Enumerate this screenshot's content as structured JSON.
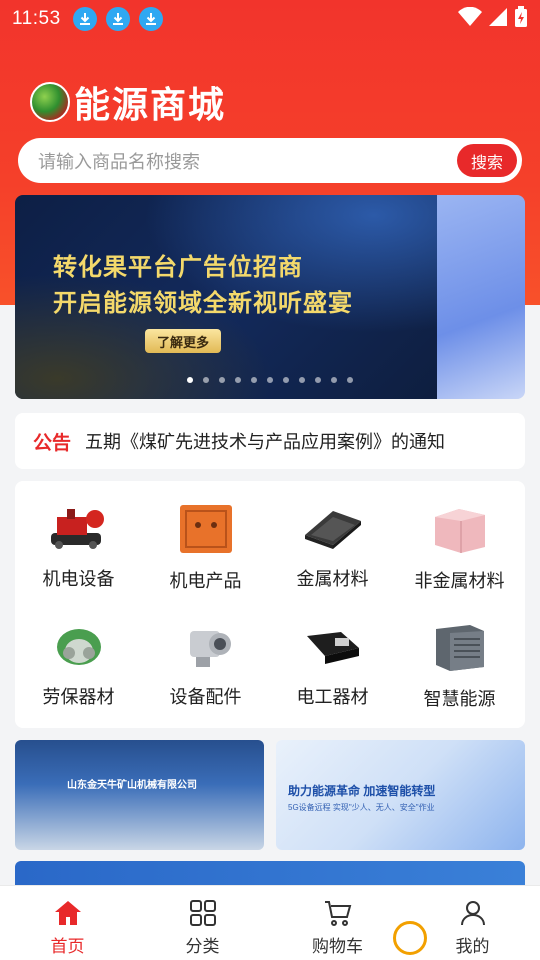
{
  "status_bar": {
    "time": "11:53"
  },
  "header": {
    "logo_text": "能源商城"
  },
  "search": {
    "placeholder": "请输入商品名称搜索",
    "button_label": "搜索"
  },
  "banner": {
    "line1": "转化果平台广告位招商",
    "line2": "开启能源领域全新视听盛宴",
    "button_label": "了解更多",
    "dot_count": 11,
    "active_dot": 0
  },
  "notice": {
    "label": "公告",
    "text": "五期《煤矿先进技术与产品应用案例》的通知"
  },
  "categories": [
    {
      "label": "机电设备",
      "icon": "mining-machine-icon"
    },
    {
      "label": "机电产品",
      "icon": "electrical-box-icon"
    },
    {
      "label": "金属材料",
      "icon": "metal-frame-icon"
    },
    {
      "label": "非金属材料",
      "icon": "pink-blocks-icon"
    },
    {
      "label": "劳保器材",
      "icon": "respirator-mask-icon"
    },
    {
      "label": "设备配件",
      "icon": "camera-part-icon"
    },
    {
      "label": "电工器材",
      "icon": "connector-icon"
    },
    {
      "label": "智慧能源",
      "icon": "cabinet-icon"
    }
  ],
  "ads": [
    {
      "title": "山东金天牛矿山机械有限公司"
    },
    {
      "title": "助力能源革命 加速智能转型",
      "sub": "5G设备远程 实现\"少人、无人、安全\"作业"
    }
  ],
  "tabbar": [
    {
      "label": "首页",
      "active": true
    },
    {
      "label": "分类",
      "active": false
    },
    {
      "label": "购物车",
      "active": false
    },
    {
      "label": "我的",
      "active": false
    }
  ],
  "colors": {
    "brand_red": "#e8292a",
    "header_red": "#f2342c"
  }
}
